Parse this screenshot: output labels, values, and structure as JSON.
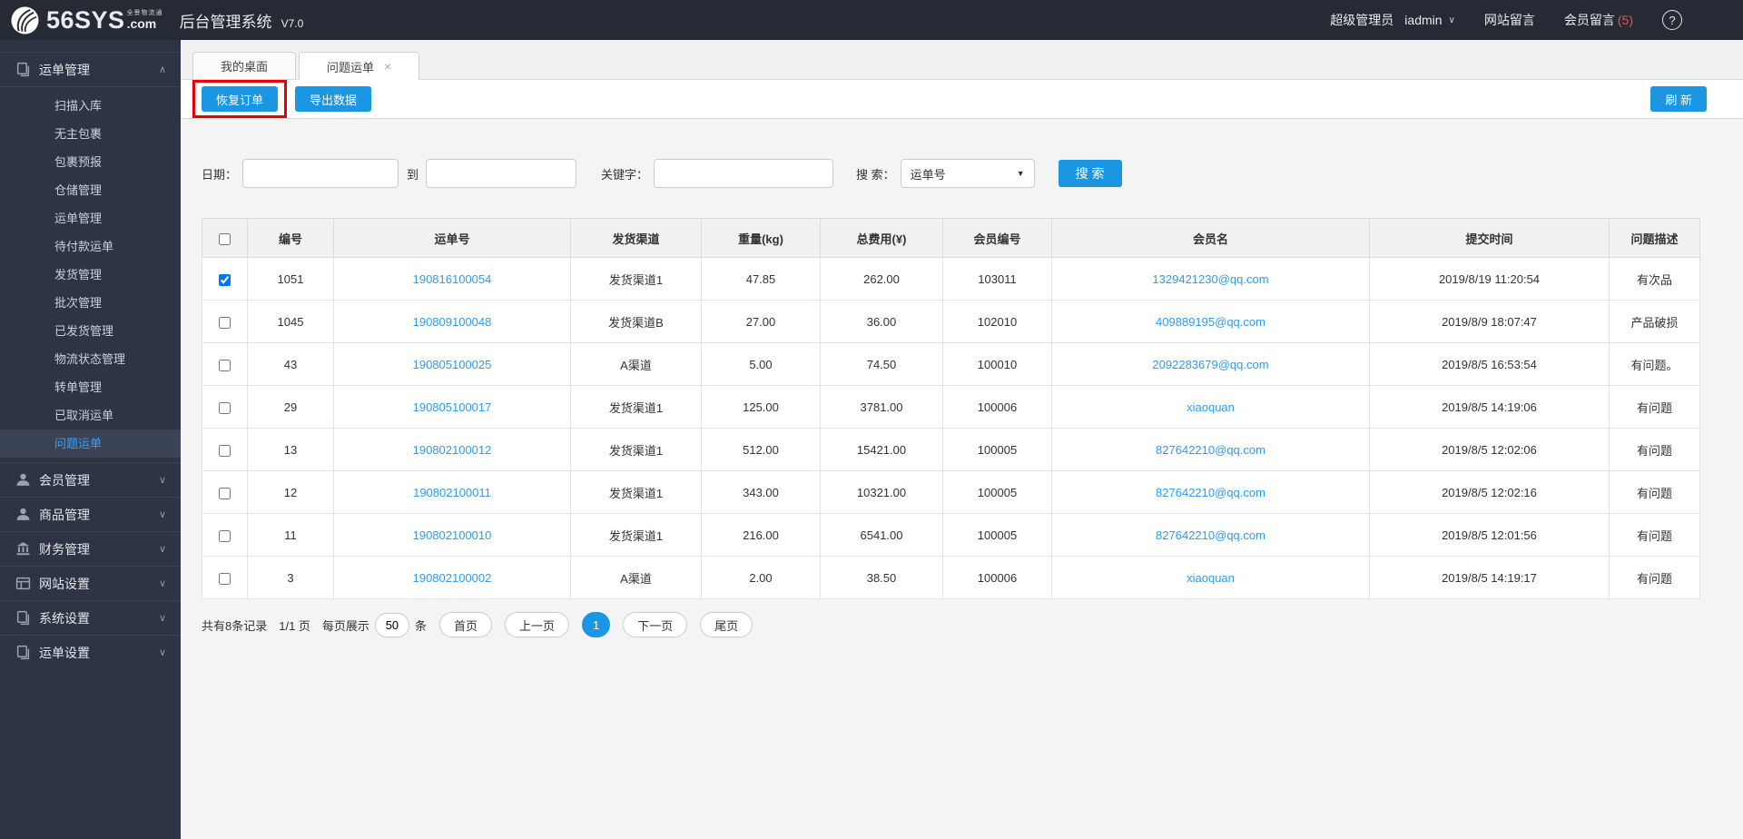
{
  "brand": {
    "logo_text": "56SYS",
    "logo_domain": ".com",
    "logo_tagline": "全景物流通",
    "app_title": "后台管理系统",
    "version": "V7.0"
  },
  "topbar": {
    "role": "超级管理员",
    "username": "iadmin",
    "nav_site_messages": "网站留言",
    "nav_member_messages": "会员留言",
    "member_message_count": "(5)",
    "help": "?"
  },
  "sidebar": {
    "sections": [
      {
        "label": "运单管理",
        "icon": "waybill-doc",
        "expanded": true,
        "items": [
          "扫描入库",
          "无主包裹",
          "包裹预报",
          "仓储管理",
          "运单管理",
          "待付款运单",
          "发货管理",
          "批次管理",
          "已发货管理",
          "物流状态管理",
          "转单管理",
          "已取消运单",
          "问题运单"
        ],
        "active_item": "问题运单"
      },
      {
        "label": "会员管理",
        "icon": "user",
        "expanded": false
      },
      {
        "label": "商品管理",
        "icon": "user",
        "expanded": false
      },
      {
        "label": "财务管理",
        "icon": "bank",
        "expanded": false
      },
      {
        "label": "网站设置",
        "icon": "browser",
        "expanded": false
      },
      {
        "label": "系统设置",
        "icon": "doc",
        "expanded": false
      },
      {
        "label": "运单设置",
        "icon": "doc",
        "expanded": false
      }
    ]
  },
  "tabs": [
    {
      "label": "我的桌面",
      "active": false,
      "closable": false
    },
    {
      "label": "问题运单",
      "active": true,
      "closable": true
    }
  ],
  "toolbar": {
    "restore": "恢复订单",
    "export": "导出数据",
    "refresh": "刷 新"
  },
  "filters": {
    "date_label": "日期：",
    "to_label": "到",
    "keyword_label": "关键字：",
    "search_by_label": "搜 索：",
    "search_type_selected": "运单号",
    "search_button": "搜 索",
    "date_from_value": "",
    "date_to_value": "",
    "keyword_value": ""
  },
  "table": {
    "columns": [
      "编号",
      "运单号",
      "发货渠道",
      "重量(kg)",
      "总费用(¥)",
      "会员编号",
      "会员名",
      "提交时间",
      "问题描述"
    ],
    "rows": [
      {
        "checked": true,
        "id": "1051",
        "waybill_no": "190816100054",
        "channel": "发货渠道1",
        "weight_kg": "47.85",
        "total_fee": "262.00",
        "member_id": "103011",
        "member_name": "1329421230@qq.com",
        "submitted_at": "2019/8/19 11:20:54",
        "issue": "有次品"
      },
      {
        "checked": false,
        "id": "1045",
        "waybill_no": "190809100048",
        "channel": "发货渠道B",
        "weight_kg": "27.00",
        "total_fee": "36.00",
        "member_id": "102010",
        "member_name": "409889195@qq.com",
        "submitted_at": "2019/8/9 18:07:47",
        "issue": "产品破损"
      },
      {
        "checked": false,
        "id": "43",
        "waybill_no": "190805100025",
        "channel": "A渠道",
        "weight_kg": "5.00",
        "total_fee": "74.50",
        "member_id": "100010",
        "member_name": "2092283679@qq.com",
        "submitted_at": "2019/8/5 16:53:54",
        "issue": "有问题。"
      },
      {
        "checked": false,
        "id": "29",
        "waybill_no": "190805100017",
        "channel": "发货渠道1",
        "weight_kg": "125.00",
        "total_fee": "3781.00",
        "member_id": "100006",
        "member_name": "xiaoquan",
        "submitted_at": "2019/8/5 14:19:06",
        "issue": "有问题"
      },
      {
        "checked": false,
        "id": "13",
        "waybill_no": "190802100012",
        "channel": "发货渠道1",
        "weight_kg": "512.00",
        "total_fee": "15421.00",
        "member_id": "100005",
        "member_name": "827642210@qq.com",
        "submitted_at": "2019/8/5 12:02:06",
        "issue": "有问题"
      },
      {
        "checked": false,
        "id": "12",
        "waybill_no": "190802100011",
        "channel": "发货渠道1",
        "weight_kg": "343.00",
        "total_fee": "10321.00",
        "member_id": "100005",
        "member_name": "827642210@qq.com",
        "submitted_at": "2019/8/5 12:02:16",
        "issue": "有问题"
      },
      {
        "checked": false,
        "id": "11",
        "waybill_no": "190802100010",
        "channel": "发货渠道1",
        "weight_kg": "216.00",
        "total_fee": "6541.00",
        "member_id": "100005",
        "member_name": "827642210@qq.com",
        "submitted_at": "2019/8/5 12:01:56",
        "issue": "有问题"
      },
      {
        "checked": false,
        "id": "3",
        "waybill_no": "190802100002",
        "channel": "A渠道",
        "weight_kg": "2.00",
        "total_fee": "38.50",
        "member_id": "100006",
        "member_name": "xiaoquan",
        "submitted_at": "2019/8/5 14:19:17",
        "issue": "有问题"
      }
    ]
  },
  "pagination": {
    "total_text": "共有8条记录",
    "page_text": "1/1 页",
    "per_page_label": "每页展示",
    "per_page_value": "50",
    "per_page_unit": "条",
    "first_label": "首页",
    "prev_label": "上一页",
    "current_page": "1",
    "next_label": "下一页",
    "last_label": "尾页"
  },
  "colors": {
    "accent_blue": "#1b96e3",
    "link_blue": "#2e9cf0",
    "annotation_red": "#e60000",
    "badge_red": "#e85454",
    "sidebar_bg": "#2d3544",
    "topbar_bg": "#252a34"
  }
}
